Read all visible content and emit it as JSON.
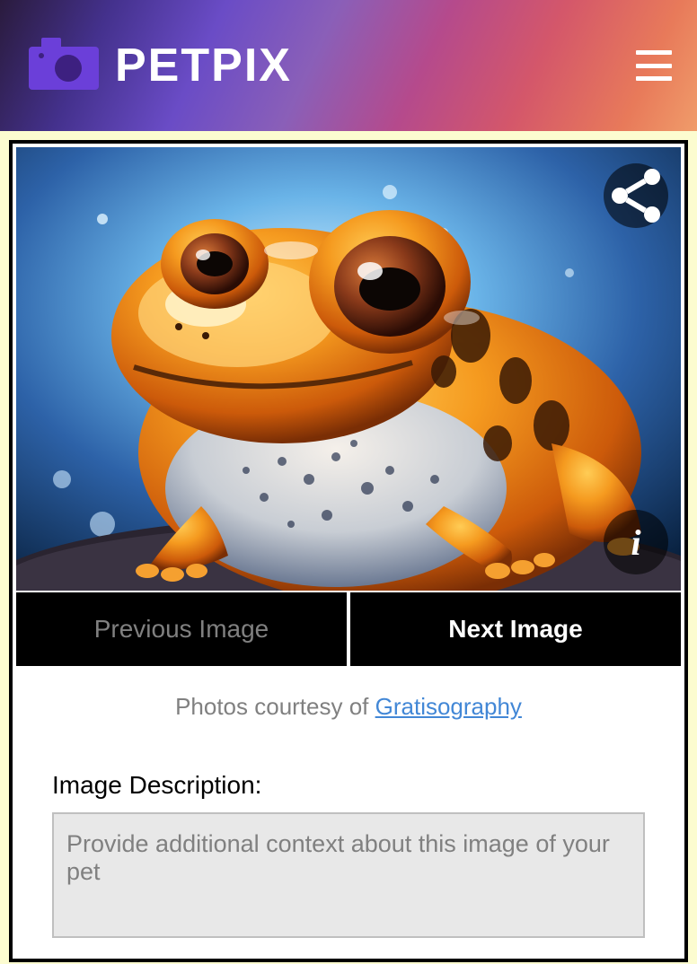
{
  "header": {
    "brand": "PETPIX"
  },
  "nav": {
    "prev_label": "Previous Image",
    "next_label": "Next Image"
  },
  "courtesy": {
    "prefix": "Photos courtesy of ",
    "link_text": "Gratisography"
  },
  "description": {
    "label": "Image Description:",
    "placeholder": "Provide additional context about this image of your pet"
  }
}
